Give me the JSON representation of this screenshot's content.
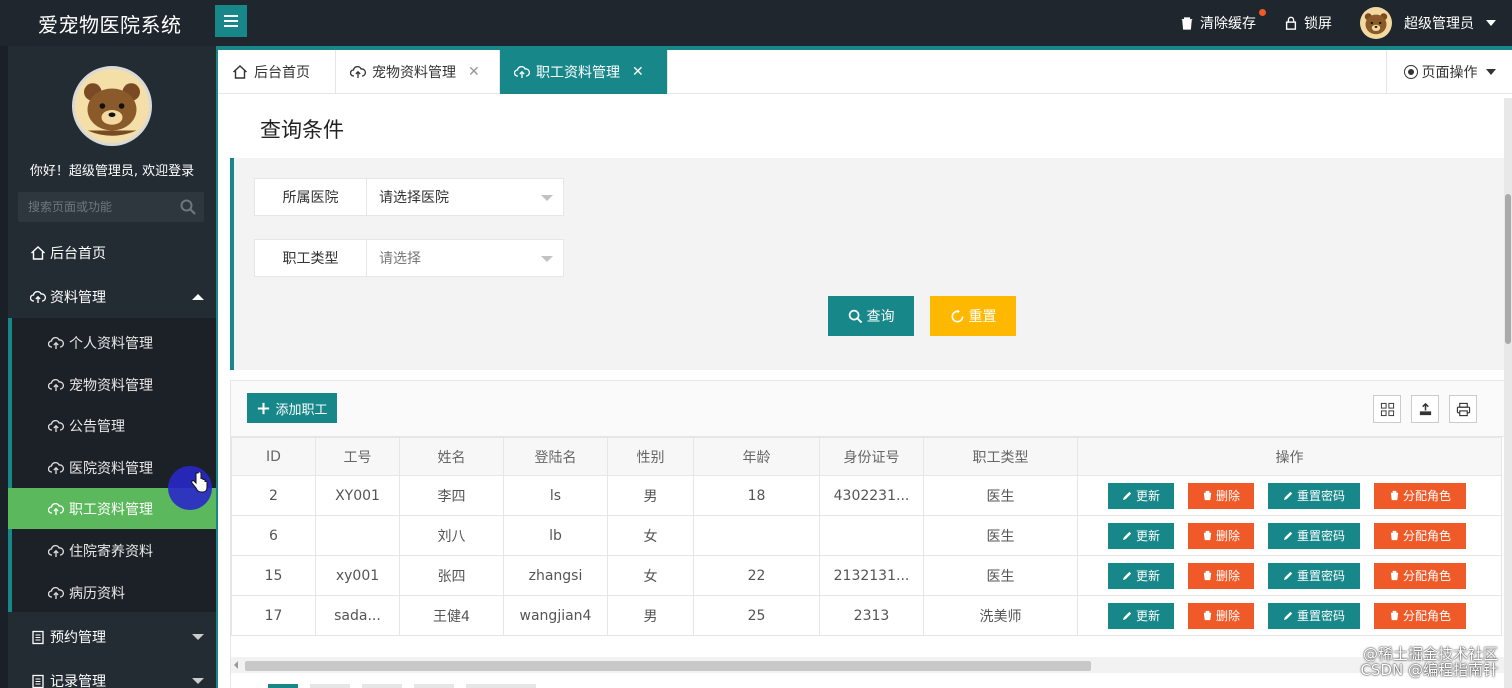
{
  "app": {
    "title": "爱宠物医院系统"
  },
  "topbar": {
    "clear_cache": "清除缓存",
    "lock_screen": "锁屏",
    "user_name": "超级管理员"
  },
  "sidebar": {
    "welcome": "你好！超级管理员, 欢迎登录",
    "search_placeholder": "搜索页面或功能",
    "home": "后台首页",
    "groups": [
      {
        "label": "资料管理",
        "expanded": true,
        "items": [
          {
            "label": "个人资料管理"
          },
          {
            "label": "宠物资料管理"
          },
          {
            "label": "公告管理"
          },
          {
            "label": "医院资料管理"
          },
          {
            "label": "职工资料管理",
            "active": true
          },
          {
            "label": "住院寄养资料"
          },
          {
            "label": "病历资料"
          }
        ]
      },
      {
        "label": "预约管理",
        "expanded": false
      },
      {
        "label": "记录管理",
        "expanded": false
      }
    ]
  },
  "tabs": [
    {
      "label": "后台首页",
      "closable": false
    },
    {
      "label": "宠物资料管理",
      "closable": true
    },
    {
      "label": "职工资料管理",
      "closable": true,
      "active": true
    }
  ],
  "page_ops": "页面操作",
  "query": {
    "title": "查询条件",
    "hospital_label": "所属医院",
    "hospital_value": "请选择医院",
    "type_label": "职工类型",
    "type_value": "请选择",
    "search_button": "查询",
    "reset_button": "重置"
  },
  "table": {
    "add_button": "添加职工",
    "columns": [
      "ID",
      "工号",
      "姓名",
      "登陆名",
      "性别",
      "年龄",
      "身份证号",
      "职工类型",
      "操作"
    ],
    "action_labels": {
      "update": "更新",
      "delete": "删除",
      "reset_password": "重置密码",
      "assign_role": "分配角色"
    },
    "rows": [
      {
        "id": "2",
        "job_no": "XY001",
        "name": "李四",
        "login": "ls",
        "gender": "男",
        "age": "18",
        "id_card": "4302231...",
        "type": "医生"
      },
      {
        "id": "6",
        "job_no": "",
        "name": "刘八",
        "login": "lb",
        "gender": "女",
        "age": "",
        "id_card": "",
        "type": "医生"
      },
      {
        "id": "15",
        "job_no": "xy001",
        "name": "张四",
        "login": "zhangsi",
        "gender": "女",
        "age": "22",
        "id_card": "2132131...",
        "type": "医生"
      },
      {
        "id": "17",
        "job_no": "sada...",
        "name": "王健4",
        "login": "wangjian4",
        "gender": "男",
        "age": "25",
        "id_card": "2313",
        "type": "洗美师"
      }
    ]
  },
  "watermark": {
    "line1": "@稀土掘金技术社区",
    "line2": "CSDN @编程指南针"
  },
  "colors": {
    "primary": "#17878a",
    "warning": "#ffb800",
    "danger": "#f05a28",
    "active_menu": "#5cb85c",
    "sidebar_bg": "#232b33",
    "topbar_bg": "#1f262d"
  }
}
